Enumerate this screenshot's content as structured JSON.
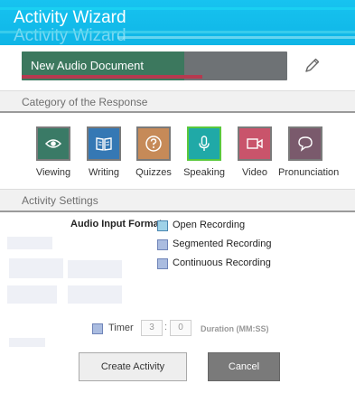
{
  "header": {
    "title": "Activity Wizard",
    "ghost_title": "Activity Wizard"
  },
  "document": {
    "name": "New Audio Document",
    "edit_icon": "pencil-icon"
  },
  "category_section": {
    "label": "Category of the Response",
    "items": [
      {
        "label": "Viewing",
        "icon": "eye-icon",
        "color": "#3a7a66"
      },
      {
        "label": "Writing",
        "icon": "book-icon",
        "color": "#3578b4"
      },
      {
        "label": "Quizzes",
        "icon": "question-icon",
        "color": "#c68a58"
      },
      {
        "label": "Speaking",
        "icon": "microphone-icon",
        "color": "#20a9a7",
        "selected": true
      },
      {
        "label": "Video",
        "icon": "video-camera-icon",
        "color": "#c9546b"
      },
      {
        "label": "Pronunciation",
        "icon": "speech-bubble-icon",
        "color": "#7a5a6c"
      }
    ]
  },
  "settings_section": {
    "label": "Activity Settings"
  },
  "audio_input": {
    "label": "Audio Input Format:",
    "options": [
      {
        "label": "Open Recording",
        "checked": true
      },
      {
        "label": "Segmented Recording",
        "checked": false
      },
      {
        "label": "Continuous Recording",
        "checked": false
      }
    ]
  },
  "timer": {
    "label": "Timer",
    "checked": false,
    "minutes": "3",
    "seconds": "0",
    "duration_label": "Duration (MM:SS)"
  },
  "buttons": {
    "create": "Create Activity",
    "cancel": "Cancel"
  }
}
